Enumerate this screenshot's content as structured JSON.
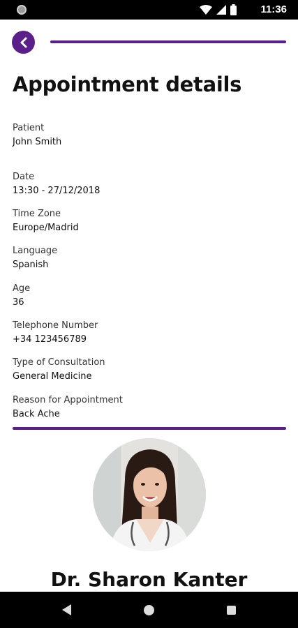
{
  "status_bar": {
    "time": "11:36",
    "icons": [
      "wifi-icon",
      "signal-icon",
      "battery-icon"
    ]
  },
  "header": {
    "back_icon": "chevron-left-icon",
    "title": "Appointment details"
  },
  "fields": [
    {
      "label": "Patient",
      "value": "John Smith"
    },
    {
      "label": "Date",
      "value": "13:30 - 27/12/2018"
    },
    {
      "label": "Time Zone",
      "value": "Europe/Madrid"
    },
    {
      "label": "Language",
      "value": "Spanish"
    },
    {
      "label": "Age",
      "value": "36"
    },
    {
      "label": "Telephone Number",
      "value": "+34 123456789"
    },
    {
      "label": "Type of Consultation",
      "value": "General Medicine"
    },
    {
      "label": "Reason for Appointment",
      "value": "Back Ache"
    }
  ],
  "doctor": {
    "name": "Dr. Sharon Kanter"
  },
  "colors": {
    "accent": "#5b1f8a"
  },
  "nav_bar": {
    "icons": [
      "nav-back-icon",
      "nav-home-icon",
      "nav-recents-icon"
    ]
  }
}
